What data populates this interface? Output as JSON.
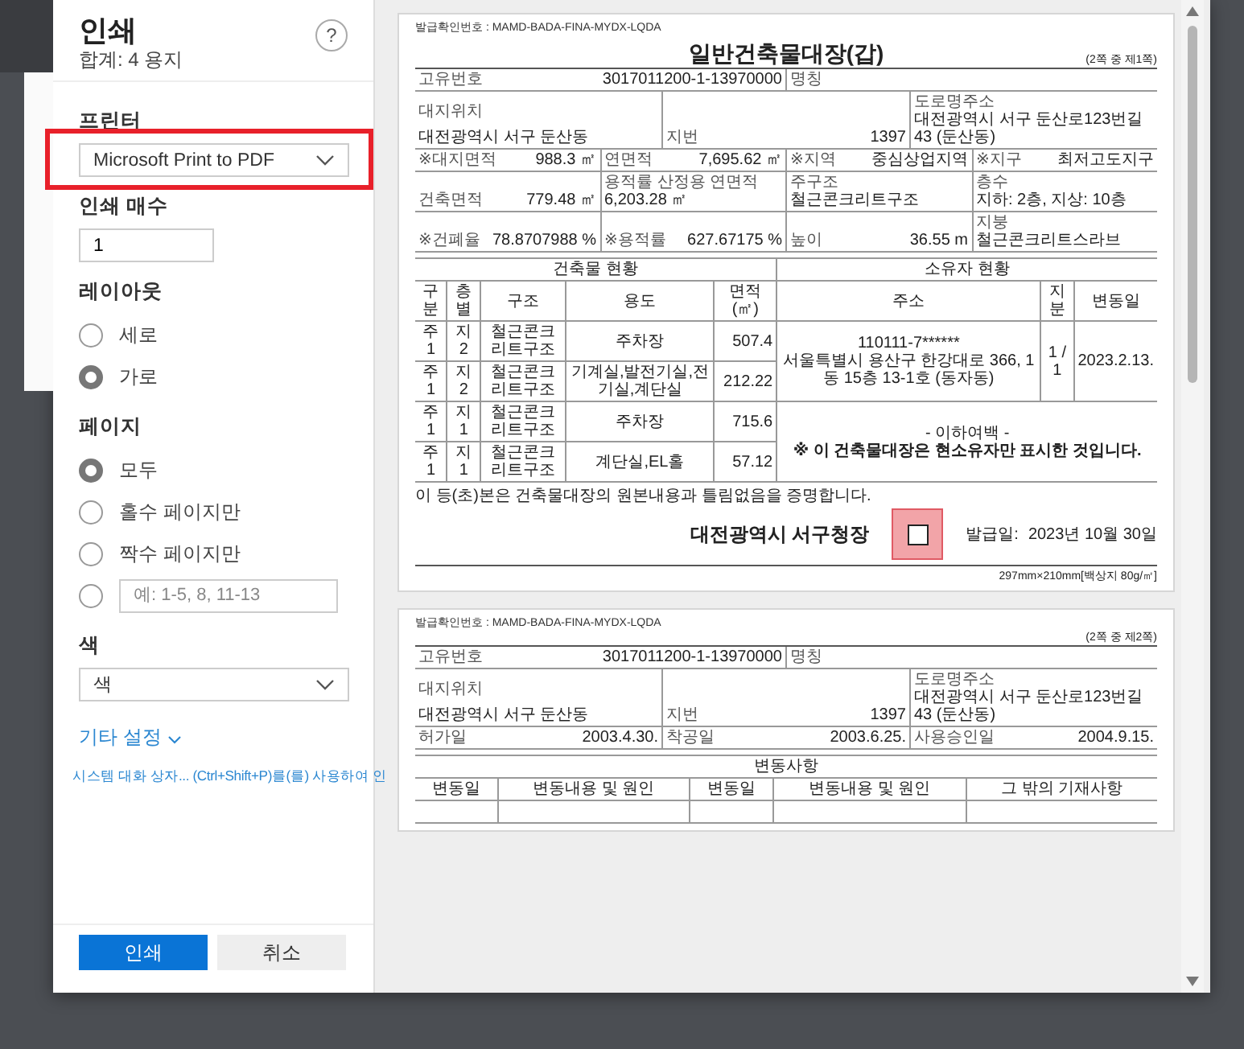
{
  "dialog": {
    "title": "인쇄",
    "subtitle": "합계: 4 용지",
    "help": "?"
  },
  "printer": {
    "label": "프린터",
    "value": "Microsoft Print to PDF",
    "highlighted": true
  },
  "copies": {
    "label": "인쇄 매수",
    "value": "1"
  },
  "layout": {
    "label": "레이아웃",
    "options": [
      {
        "label": "세로",
        "selected": false
      },
      {
        "label": "가로",
        "selected": true
      }
    ]
  },
  "pages": {
    "label": "페이지",
    "options": [
      {
        "kind": "option",
        "label": "모두",
        "selected": true
      },
      {
        "kind": "option",
        "label": "홀수 페이지만",
        "selected": false
      },
      {
        "kind": "option",
        "label": "짝수 페이지만",
        "selected": false
      },
      {
        "kind": "range",
        "placeholder": "예: 1-5, 8, 11-13",
        "selected": false
      }
    ]
  },
  "color": {
    "label": "색",
    "value": "색"
  },
  "more_settings": "기타 설정",
  "system_dialog_link": "시스템 대화 상자... (Ctrl+Shift+P)를(를) 사용하여 인",
  "buttons": [
    {
      "kind": "primary",
      "label": "인쇄"
    },
    {
      "kind": "secondary",
      "label": "취소"
    }
  ],
  "preview": {
    "pages": [
      {
        "confirm_no": "발급확인번호 : MAMD-BADA-FINA-MYDX-LQDA",
        "title": "일반건축물대장(갑)",
        "page_no": "(2쪽 중 제1쪽)",
        "summary": [
          [
            {
              "label": "고유번호",
              "value": "3017011200-1-13970000"
            },
            {
              "label": "명칭"
            }
          ],
          [
            {
              "label": "대지위치",
              "value": "대전광역시 서구 둔산동"
            },
            {
              "label": "지번",
              "value": "1397"
            },
            {
              "label": "도로명주소",
              "value": "대전광역시 서구 둔산로123번길 43 (둔산동)"
            }
          ],
          [
            {
              "label": "※대지면적",
              "value": "988.3 ㎡"
            },
            {
              "label": "연면적",
              "value": "7,695.62 ㎡"
            },
            {
              "label": "※지역",
              "value": "중심상업지역"
            },
            {
              "label": "※지구",
              "value": "최저고도지구"
            }
          ],
          [
            {
              "label": "건축면적",
              "value": "779.48 ㎡"
            },
            {
              "label": "용적률 산정용 연면적",
              "value": "6,203.28 ㎡"
            },
            {
              "label": "주구조",
              "value": "철근콘크리트구조"
            },
            {
              "label": "층수",
              "value": "지하: 2층, 지상: 10층"
            }
          ],
          [
            {
              "label": "※건폐율",
              "value": "78.8707988 %"
            },
            {
              "label": "※용적률",
              "value": "627.67175 %"
            },
            {
              "label": "높이",
              "value": "36.55 m"
            },
            {
              "label": "지붕",
              "value": "철근콘크리트스라브"
            }
          ]
        ],
        "status": {
          "building_title": "건축물 현황",
          "owner_title": "소유자 현황",
          "columns": [
            "구분",
            "층별",
            "구조",
            "용도",
            "면적(㎡)"
          ],
          "rows": [
            [
              "주1",
              "지2",
              "철근콘크리트구조",
              "주차장",
              "507.4"
            ],
            [
              "주1",
              "지2",
              "철근콘크리트구조",
              "기계실,발전기실,전기실,계단실",
              "212.22"
            ],
            [
              "주1",
              "지1",
              "철근콘크리트구조",
              "주차장",
              "715.6"
            ],
            [
              "주1",
              "지1",
              "철근콘크리트구조",
              "계단실,EL홀",
              "57.12"
            ]
          ],
          "owner_columns": [
            "주소",
            "지분",
            "변동일"
          ],
          "owner": {
            "id": "110111-7******",
            "address": "서울특별시 용산구 한강대로 366, 1동 15층 13-1호 (동자동)",
            "share": "1 / 1",
            "date": "2023.2.13.",
            "end": "- 이하여백 -",
            "note": "※ 이 건축물대장은 현소유자만 표시한 것입니다."
          }
        },
        "certify": "이 등(초)본은 건축물대장의 원본내용과 틀림없음을 증명합니다.",
        "issuer": "대전광역시 서구청장",
        "issue_label": "발급일:",
        "issue_date": "2023년 10월 30일",
        "paper": "297mm×210mm[백상지 80g/㎡]"
      },
      {
        "confirm_no": "발급확인번호 : MAMD-BADA-FINA-MYDX-LQDA",
        "page_no": "(2쪽 중 제2쪽)",
        "summary": [
          [
            {
              "label": "고유번호",
              "value": "3017011200-1-13970000"
            },
            {
              "label": "명칭"
            }
          ],
          [
            {
              "label": "대지위치",
              "value": "대전광역시 서구 둔산동"
            },
            {
              "label": "지번",
              "value": "1397"
            },
            {
              "label": "도로명주소",
              "value": "대전광역시 서구 둔산로123번길 43 (둔산동)"
            }
          ],
          [
            {
              "label": "허가일",
              "value": "2003.4.30."
            },
            {
              "label": "착공일",
              "value": "2003.6.25."
            },
            {
              "label": "사용승인일",
              "value": "2004.9.15."
            }
          ]
        ],
        "changes_title": "변동사항",
        "change_columns": [
          "변동일",
          "변동내용 및 원인",
          "변동일",
          "변동내용 및 원인",
          "그 밖의 기재사항"
        ]
      }
    ]
  }
}
